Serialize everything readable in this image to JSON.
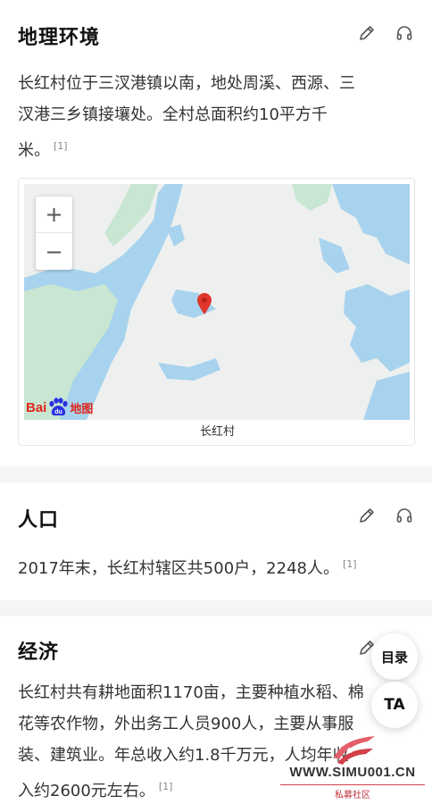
{
  "sections": {
    "geography": {
      "title": "地理环境",
      "line1": "长红村位于三汊港镇以南，地处周溪、西源、三",
      "line2": "汊港三乡镇接壤处。全村总面积约10平方千",
      "line3": "米。",
      "cite": "[1]",
      "map": {
        "caption": "长红村",
        "zoom_in": "+",
        "zoom_out": "−",
        "logo_bai": "Bai",
        "logo_map": "地图",
        "colors": {
          "water": "#a8d3ee",
          "land": "#eef0ef",
          "green": "#c8e6d2",
          "pin": "#e0362c"
        }
      }
    },
    "population": {
      "title": "人口",
      "text": "2017年末，长红村辖区共500户，2248人。",
      "cite": "[1]"
    },
    "economy": {
      "title": "经济",
      "line1": "长红村共有耕地面积1170亩，主要种植水稻、棉",
      "line2": "花等农作物，外出务工人员900人，主要从事服",
      "line3": "装、建筑业。年总收入约1.8千万元，人均年收",
      "line4": "入约2600元左右。",
      "cite": "[1]"
    }
  },
  "floating": {
    "toc": "目录",
    "font_size": "TA"
  },
  "watermark": {
    "url": "WWW.SIMU001.CN",
    "sub": "私募社区"
  }
}
